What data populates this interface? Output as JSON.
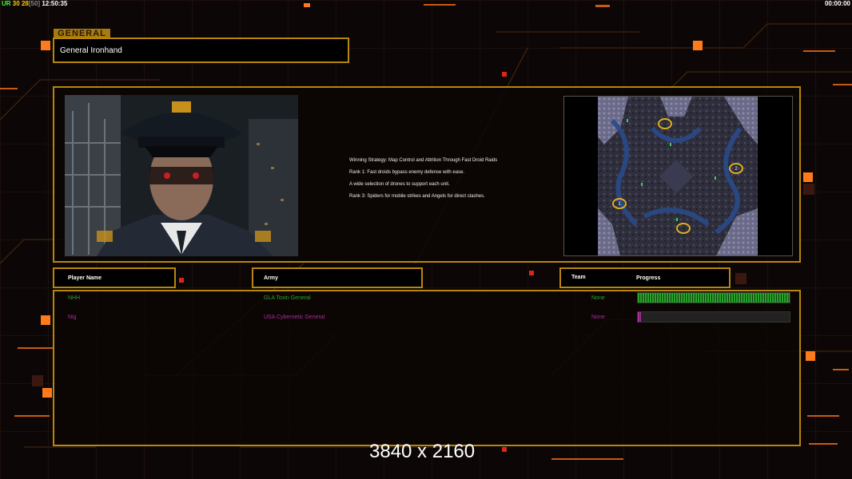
{
  "hud": {
    "ur_label": "UR",
    "fps": "30",
    "value2": "28",
    "value3": "[50]",
    "clock": "12:50:35",
    "timer": "00:00:00"
  },
  "general": {
    "tag": "GENERAL",
    "name": "General Ironhand"
  },
  "strategy": {
    "lines": [
      "Winning Strategy: Map Control and Attrition Through Fast Droid Raids",
      "Rank 1: Fast droids bypass enemy defense with ease.",
      "A wide selection of drones to support each unit.",
      "Rank 3: Spiders for mobile strikes and Angels for direct clashes."
    ]
  },
  "map": {
    "start_positions": [
      "1",
      "2"
    ]
  },
  "table": {
    "headers": {
      "player_name": "Player Name",
      "army": "Army",
      "team": "Team",
      "progress": "Progress"
    },
    "rows": [
      {
        "player": "NHH",
        "army": "GLA Toxin General",
        "team": "None",
        "color": "#2aa52a",
        "progress": 1.0
      },
      {
        "player": "Nig",
        "army": "USA Cybernetic General",
        "team": "None",
        "color": "#b02aa0",
        "progress": 0.02
      }
    ]
  },
  "resolution_label": "3840 x 2160",
  "colors": {
    "accent": "#b8860b",
    "hud_orange": "#ff7a1a",
    "hud_green": "#3cff3c",
    "hud_yellow": "#ffd000"
  }
}
